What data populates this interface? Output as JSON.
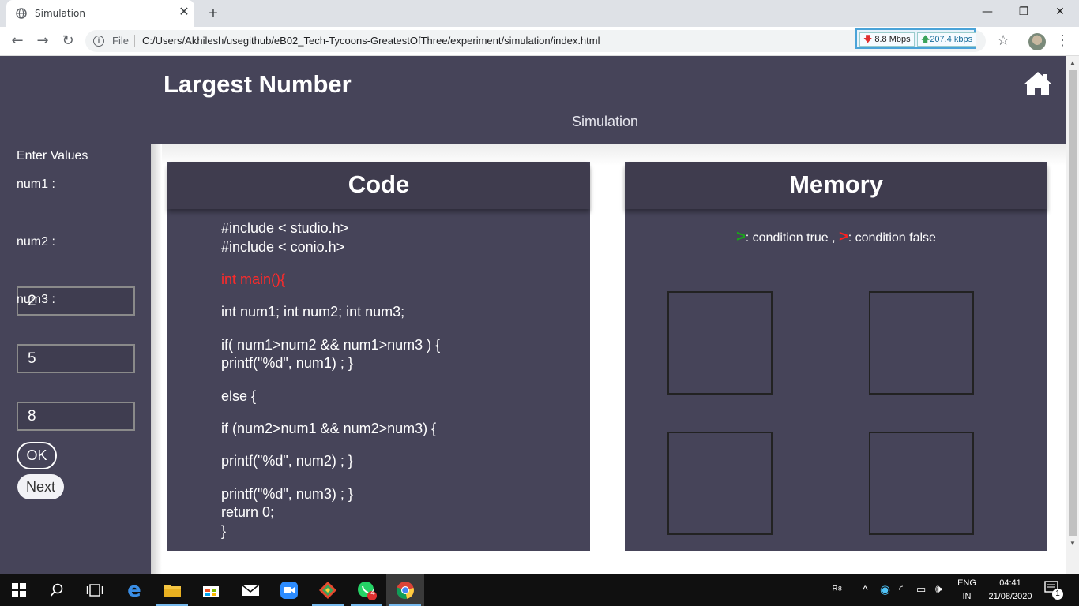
{
  "browser": {
    "tab_title": "Simulation",
    "new_tab_symbol": "+",
    "close_tab_symbol": "✕",
    "window_controls": {
      "minimize": "—",
      "restore": "❐",
      "close": "✕"
    },
    "nav": {
      "back": "←",
      "forward": "→",
      "reload": "↻"
    },
    "file_label": "File",
    "url": "C:/Users/Akhilesh/usegithub/eB02_Tech-Tycoons-GreatestOfThree/experiment/simulation/index.html",
    "download_speed": "8.8 Mbps",
    "upload_speed": "207.4 kbps"
  },
  "header": {
    "title": "Largest Number",
    "subtitle": "Simulation"
  },
  "sidebar": {
    "enter_label": "Enter Values",
    "inputs": [
      {
        "label": "num1 :",
        "value": "2"
      },
      {
        "label": "num2 :",
        "value": "5"
      },
      {
        "label": "num3 :",
        "value": "8"
      }
    ],
    "ok_label": "OK",
    "next_label": "Next"
  },
  "code_panel": {
    "title": "Code",
    "lines": [
      "#include < studio.h>",
      "#include < conio.h>",
      "int main(){",
      "int num1; int num2; int num3;",
      "if( num1>num2 && num1>num3 ) {",
      "printf(\"%d\", num1) ; }",
      "else {",
      "if (num2>num1 && num2>num3) {",
      "printf(\"%d\", num2) ; }",
      "printf(\"%d\", num3) ; }",
      "return 0;",
      "}"
    ],
    "highlighted_line_index": 2,
    "highlight_color": "#ff2a2a"
  },
  "memory_panel": {
    "title": "Memory",
    "legend_true_symbol": ">",
    "legend_true": ": condition true ,",
    "legend_false_symbol": ">",
    "legend_false": ": condition false",
    "true_color": "#1aa51a",
    "false_color": "#ff2020"
  },
  "taskbar": {
    "whatsapp_badge": "4",
    "language_top": "ENG",
    "language_bottom": "IN",
    "time": "04:41",
    "date": "21/08/2020",
    "notification_count": "1"
  },
  "colors": {
    "panel_bg": "#464459",
    "panel_head": "#3f3c4e"
  }
}
